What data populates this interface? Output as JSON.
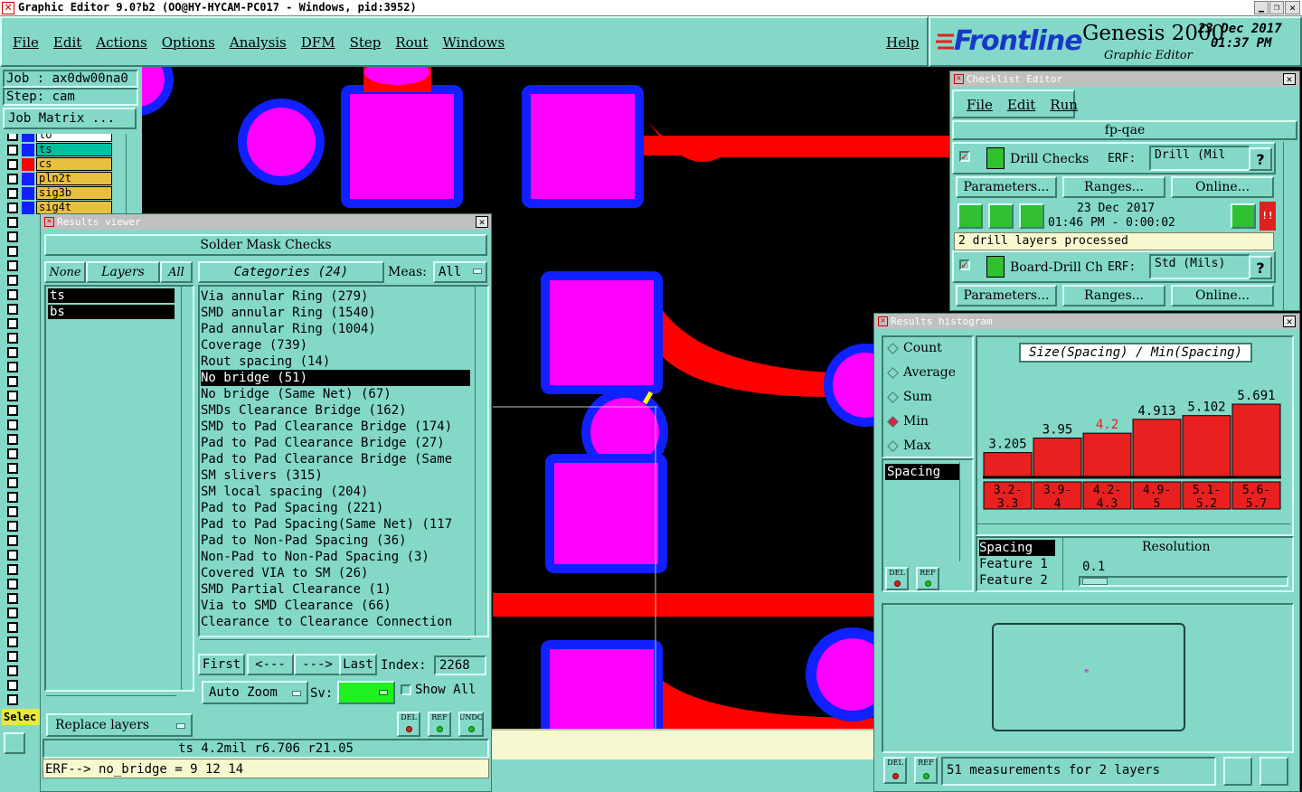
{
  "app": {
    "title": "Graphic Editor 9.0?b2 (OO@HY-HYCAM-PC017 - Windows, pid:3952)"
  },
  "menu": {
    "items": [
      "File",
      "Edit",
      "Actions",
      "Options",
      "Analysis",
      "DFM",
      "Step",
      "Rout",
      "Windows"
    ],
    "help": "Help"
  },
  "brand": {
    "logo": "Frontline",
    "product": "Genesis 2000",
    "subtitle": "Graphic Editor",
    "date": "23 Dec 2017",
    "time": "01:37 PM"
  },
  "job": {
    "job_label": "Job : ax0dw00na0",
    "step_label": "Step: cam",
    "matrix_button": "Job Matrix ..."
  },
  "layers_strip": {
    "items": [
      "to",
      "ts",
      "cs",
      "pln2t",
      "sig3b",
      "sig4t"
    ],
    "colors": [
      "#ffffff",
      "#00c0a0",
      "#e8c040",
      "#e8c040",
      "#e8c040",
      "#e8c040"
    ]
  },
  "select_label": "Selec",
  "results_viewer": {
    "window_title": "Results viewer",
    "header": "Solder Mask Checks",
    "none_btn": "None",
    "layers_btn": "Layers",
    "all_btn": "All",
    "layers": [
      "ts",
      "bs"
    ],
    "categories_btn": "Categories (24)",
    "meas_label": "Meas:",
    "meas_value": "All",
    "categories": [
      "Via annular Ring (279)",
      "SMD annular Ring (1540)",
      "Pad annular Ring (1004)",
      "Coverage (739)",
      "Rout spacing (14)",
      "No bridge (51)",
      "No bridge (Same Net) (67)",
      "SMDs Clearance Bridge (162)",
      "SMD to Pad Clearance Bridge (174)",
      "Pad to Pad Clearance Bridge (27)",
      "Pad to Pad Clearance Bridge (Same",
      "SM slivers (315)",
      "SM local spacing (204)",
      "Pad to Pad Spacing (221)",
      "Pad to Pad Spacing(Same Net) (117",
      "Pad to Non-Pad Spacing (36)",
      "Non-Pad to Non-Pad Spacing (3)",
      "Covered VIA to SM (26)",
      "SMD Partial Clearance (1)",
      "Via to SMD Clearance (66)",
      "Clearance to Clearance Connection"
    ],
    "selected_category": "No bridge (51)",
    "first_btn": "First",
    "prev_btn": "<---",
    "next_btn": "--->",
    "last_btn": "Last",
    "index_label": "Index:",
    "index_value": "2268",
    "auto_zoom": "Auto Zoom",
    "sv_label": "Sv:",
    "show_all": "Show All",
    "replace_layers": "Replace layers",
    "del": "DEL",
    "ref": "REF",
    "undo": "UNDO",
    "status": "ts 4.2mil   r6.706  r21.05",
    "erf_line": "ERF--> no_bridge = 9 12 14"
  },
  "checklist_editor": {
    "window_title": "Checklist Editor",
    "menu": [
      "File",
      "Edit",
      "Run"
    ],
    "name": "fp-qae",
    "checks": [
      {
        "name": "Drill Checks",
        "erf": "ERF:",
        "erf_value": "Drill (Mil",
        "help": "?"
      },
      {
        "name": "Board-Drill Che",
        "erf": "ERF:",
        "erf_value": "Std (Mils)",
        "help": "?"
      }
    ],
    "params_btn": "Parameters...",
    "ranges_btn": "Ranges...",
    "online_btn": "Online...",
    "run_date": "23 Dec 2017",
    "run_time": "01:46 PM - 0:00:02",
    "run_status": "2 drill layers processed",
    "alert": "!!"
  },
  "histogram": {
    "window_title": "Results histogram",
    "modes": [
      "Count",
      "Average",
      "Sum",
      "Min",
      "Max"
    ],
    "selected_mode": "Min",
    "chart_title": "Size(Spacing) / Min(Spacing)",
    "measure_list": [
      "Spacing"
    ],
    "feature_list": [
      "Spacing",
      "Feature 1",
      "Feature 2"
    ],
    "resolution_label": "Resolution",
    "resolution_value": "0.1",
    "del": "DEL",
    "ref": "REF",
    "status": "51 measurements for 2 layers"
  },
  "chart_data": {
    "type": "bar",
    "title": "Size(Spacing) / Min(Spacing)",
    "categories": [
      "3.2-3.3",
      "3.9-4",
      "4.2-4.3",
      "4.9-5",
      "5.1-5.2",
      "5.6-5.7"
    ],
    "category_lines": [
      [
        "3.2-",
        "3.3"
      ],
      [
        "3.9-",
        "4"
      ],
      [
        "4.2-",
        "4.3"
      ],
      [
        "4.9-",
        "5"
      ],
      [
        "5.1-",
        "5.2"
      ],
      [
        "5.6-",
        "5.7"
      ]
    ],
    "values": [
      3.205,
      3.95,
      4.2,
      4.913,
      5.102,
      5.691
    ],
    "value_labels": [
      "3.205",
      "3.95",
      "4.2",
      "4.913",
      "5.102",
      "5.691"
    ],
    "highlight_index": 2,
    "bar_color": "#e82020",
    "highlight_color": "#e82020",
    "ylim": [
      0,
      5.691
    ]
  },
  "colors": {
    "panel": "#84d8c8",
    "pad_fill": "#ff00ff",
    "pad_outline": "#1020ff",
    "trace": "#ff0000",
    "canvas": "#000000"
  }
}
